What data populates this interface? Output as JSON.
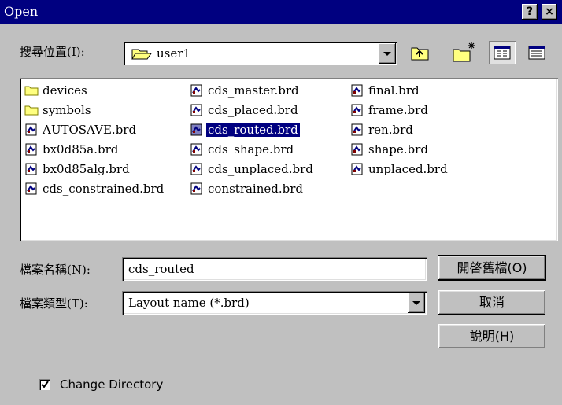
{
  "window": {
    "title": "Open",
    "help_label": "?",
    "close_label": "×"
  },
  "look_in": {
    "label": "搜尋位置(I):",
    "value": "user1"
  },
  "files": [
    {
      "name": "devices",
      "type": "folder"
    },
    {
      "name": "symbols",
      "type": "folder"
    },
    {
      "name": "AUTOSAVE.brd",
      "type": "file"
    },
    {
      "name": "bx0d85a.brd",
      "type": "file"
    },
    {
      "name": "bx0d85alg.brd",
      "type": "file"
    },
    {
      "name": "cds_constrained.brd",
      "type": "file"
    },
    {
      "name": "cds_master.brd",
      "type": "file"
    },
    {
      "name": "cds_placed.brd",
      "type": "file"
    },
    {
      "name": "cds_routed.brd",
      "type": "file",
      "selected": true
    },
    {
      "name": "cds_shape.brd",
      "type": "file"
    },
    {
      "name": "cds_unplaced.brd",
      "type": "file"
    },
    {
      "name": "constrained.brd",
      "type": "file"
    },
    {
      "name": "final.brd",
      "type": "file"
    },
    {
      "name": "frame.brd",
      "type": "file"
    },
    {
      "name": "ren.brd",
      "type": "file"
    },
    {
      "name": "shape.brd",
      "type": "file"
    },
    {
      "name": "unplaced.brd",
      "type": "file"
    }
  ],
  "filename": {
    "label": "檔案名稱(N):",
    "value": "cds_routed"
  },
  "filetype": {
    "label": "檔案類型(T):",
    "value": "Layout name (*.brd)"
  },
  "buttons": {
    "open": "開啓舊檔(O)",
    "cancel": "取消",
    "help": "說明(H)"
  },
  "change_directory": {
    "label": "Change Directory",
    "checked": true
  },
  "colors": {
    "titlebar": "#000080",
    "face": "#c0c0c0",
    "folder": "#ffff80"
  },
  "icons": [
    "help-icon",
    "close-icon",
    "folder-icon",
    "up-folder-icon",
    "new-folder-icon",
    "list-view-icon",
    "details-view-icon",
    "file-icon",
    "dropdown-arrow-icon",
    "checkmark-icon"
  ]
}
